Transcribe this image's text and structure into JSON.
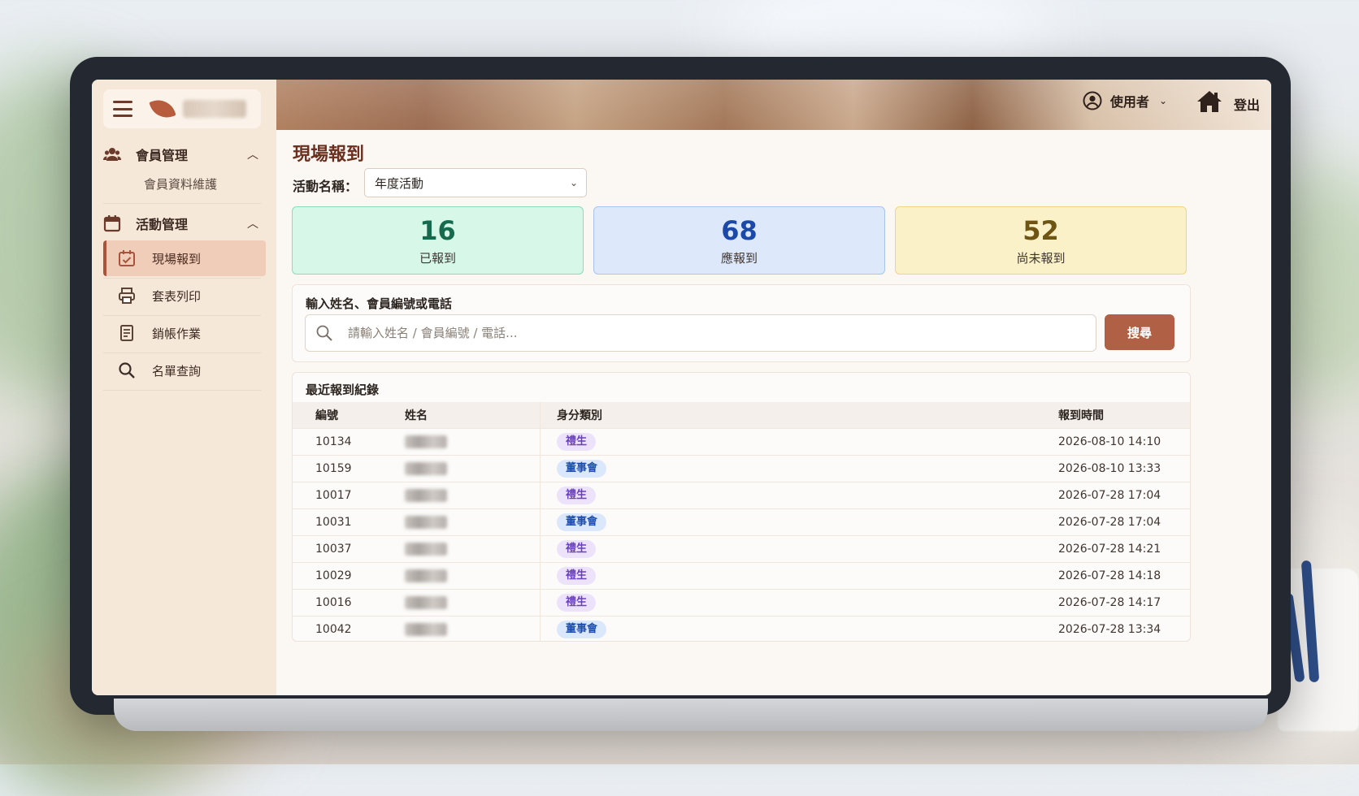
{
  "header": {
    "user_name": "使用者",
    "logout_label": "登出"
  },
  "sidebar": {
    "groups": [
      {
        "label": "會員管理",
        "icon": "users-icon",
        "sub": [
          "會員資料維護"
        ]
      },
      {
        "label": "活動管理",
        "icon": "calendar-icon"
      }
    ],
    "items": [
      {
        "label": "現場報到",
        "icon": "check-calendar-icon",
        "active": true
      },
      {
        "label": "套表列印",
        "icon": "printer-icon"
      },
      {
        "label": "銷帳作業",
        "icon": "document-icon"
      },
      {
        "label": "名單查詢",
        "icon": "search-icon"
      }
    ]
  },
  "main": {
    "title": "現場報到",
    "event_label": "活動名稱：",
    "event_value": "年度活動",
    "stats": [
      {
        "value": "16",
        "label": "已報到",
        "color": "#166a4d"
      },
      {
        "value": "68",
        "label": "應報到",
        "color": "#1c49a8"
      },
      {
        "value": "52",
        "label": "尚未報到",
        "color": "#6f5513"
      }
    ],
    "search": {
      "title": "輸入姓名、會員編號或電話",
      "placeholder": "請輸入姓名 / 會員編號 / 電話...",
      "button": "搜尋"
    },
    "records": {
      "title": "最近報到紀錄",
      "columns": [
        "編號",
        "姓名",
        "身分類別",
        "報到時間"
      ],
      "rows": [
        {
          "id": "10134",
          "type": "禮生",
          "time": "2026-08-10 14:10"
        },
        {
          "id": "10159",
          "type": "董事會",
          "time": "2026-08-10 13:33"
        },
        {
          "id": "10017",
          "type": "禮生",
          "time": "2026-07-28 17:04"
        },
        {
          "id": "10031",
          "type": "董事會",
          "time": "2026-07-28 17:04"
        },
        {
          "id": "10037",
          "type": "禮生",
          "time": "2026-07-28 14:21"
        },
        {
          "id": "10029",
          "type": "禮生",
          "time": "2026-07-28 14:18"
        },
        {
          "id": "10016",
          "type": "禮生",
          "time": "2026-07-28 14:17"
        },
        {
          "id": "10042",
          "type": "董事會",
          "time": "2026-07-28 13:34"
        }
      ]
    }
  }
}
